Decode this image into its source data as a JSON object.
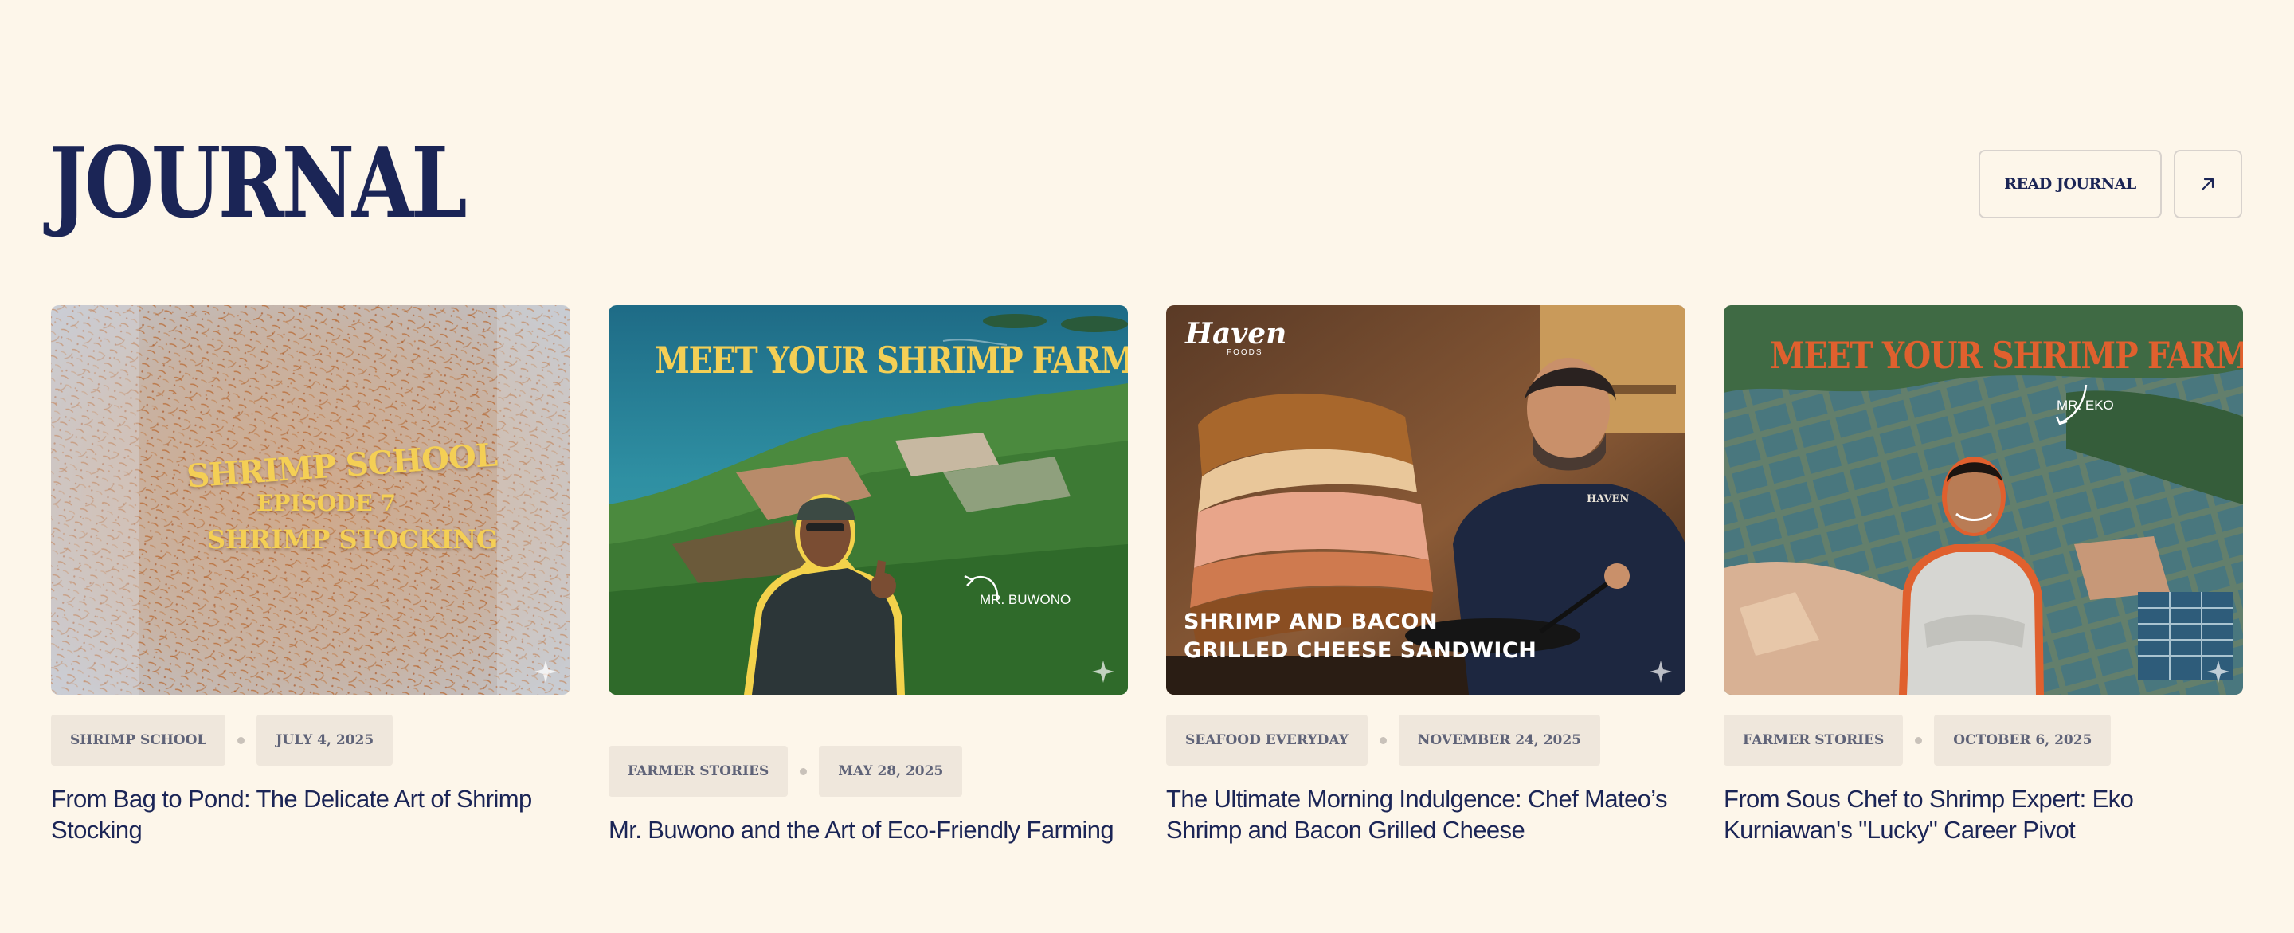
{
  "header": {
    "title": "JOURNAL",
    "read_button": "READ JOURNAL",
    "arrow_icon": "arrow-up-right-icon"
  },
  "colors": {
    "background": "#fdf6ea",
    "navy": "#1b2556",
    "tag_bg": "#efe7dc",
    "yellow": "#f4cf55",
    "orange": "#e0602e"
  },
  "cards": [
    {
      "category": "SHRIMP SCHOOL",
      "date": "JULY 4, 2025",
      "title": "From Bag to Pond: The Delicate Art of Shrimp Stocking",
      "image": {
        "line1": "SHRIMP SCHOOL",
        "line2": "EPISODE 7",
        "line3": "SHRIMP STOCKING"
      }
    },
    {
      "category": "FARMER STORIES",
      "date": "MAY 28, 2025",
      "title": "Mr. Buwono and the Art of Eco-Friendly Farming",
      "image": {
        "headline": "MEET YOUR SHRIMP FARMER",
        "name_label": "MR. BUWONO"
      }
    },
    {
      "category": "SEAFOOD EVERYDAY",
      "date": "NOVEMBER 24, 2025",
      "title": "The Ultimate Morning Indulgence: Chef Mateo’s Shrimp and Bacon Grilled Cheese",
      "image": {
        "logo": "Haven",
        "logo_sub": "FOODS",
        "line1": "SHRIMP AND BACON",
        "line2": "GRILLED CHEESE SANDWICH",
        "hoodie_text": "HAVEN"
      }
    },
    {
      "category": "FARMER STORIES",
      "date": "OCTOBER 6, 2025",
      "title": "From Sous Chef to Shrimp Expert: Eko Kurniawan's \"Lucky\" Career Pivot",
      "image": {
        "headline": "MEET YOUR SHRIMP FARMER",
        "name_label": "MR. EKO"
      }
    }
  ]
}
